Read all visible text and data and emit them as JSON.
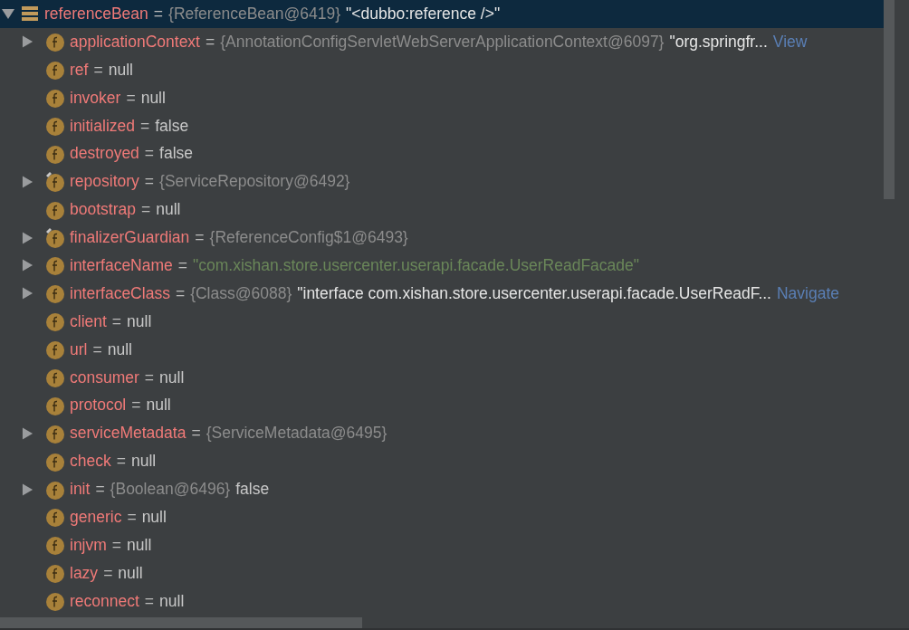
{
  "equals": "=",
  "root": {
    "name": "referenceBean",
    "expanded": true,
    "selected": true,
    "parts": [
      {
        "kind": "type",
        "text": "{ReferenceBean@6419}"
      },
      {
        "kind": "string",
        "text": "\"<dubbo:reference />\""
      }
    ]
  },
  "children": [
    {
      "name": "applicationContext",
      "expandable": true,
      "expanded": false,
      "pinned": false,
      "parts": [
        {
          "kind": "type",
          "text": "{AnnotationConfigServletWebServerApplicationContext@6097}"
        },
        {
          "kind": "string",
          "text": "\"org.springfr..."
        },
        {
          "kind": "link",
          "text": "View"
        }
      ]
    },
    {
      "name": "ref",
      "expandable": false,
      "pinned": false,
      "parts": [
        {
          "kind": "plain",
          "text": "null"
        }
      ]
    },
    {
      "name": "invoker",
      "expandable": false,
      "pinned": false,
      "parts": [
        {
          "kind": "plain",
          "text": "null"
        }
      ]
    },
    {
      "name": "initialized",
      "expandable": false,
      "pinned": false,
      "parts": [
        {
          "kind": "plain",
          "text": "false"
        }
      ]
    },
    {
      "name": "destroyed",
      "expandable": false,
      "pinned": false,
      "parts": [
        {
          "kind": "plain",
          "text": "false"
        }
      ]
    },
    {
      "name": "repository",
      "expandable": true,
      "expanded": false,
      "pinned": true,
      "parts": [
        {
          "kind": "type",
          "text": "{ServiceRepository@6492}"
        }
      ]
    },
    {
      "name": "bootstrap",
      "expandable": false,
      "pinned": false,
      "parts": [
        {
          "kind": "plain",
          "text": "null"
        }
      ]
    },
    {
      "name": "finalizerGuardian",
      "expandable": true,
      "expanded": false,
      "pinned": true,
      "parts": [
        {
          "kind": "type",
          "text": "{ReferenceConfig$1@6493}"
        }
      ]
    },
    {
      "name": "interfaceName",
      "expandable": true,
      "expanded": false,
      "pinned": false,
      "parts": [
        {
          "kind": "green",
          "text": "\"com.xishan.store.usercenter.userapi.facade.UserReadFacade\""
        }
      ]
    },
    {
      "name": "interfaceClass",
      "expandable": true,
      "expanded": false,
      "pinned": false,
      "parts": [
        {
          "kind": "type",
          "text": "{Class@6088}"
        },
        {
          "kind": "string",
          "text": "\"interface com.xishan.store.usercenter.userapi.facade.UserReadF..."
        },
        {
          "kind": "link",
          "text": "Navigate"
        }
      ]
    },
    {
      "name": "client",
      "expandable": false,
      "pinned": false,
      "parts": [
        {
          "kind": "plain",
          "text": "null"
        }
      ]
    },
    {
      "name": "url",
      "expandable": false,
      "pinned": false,
      "parts": [
        {
          "kind": "plain",
          "text": "null"
        }
      ]
    },
    {
      "name": "consumer",
      "expandable": false,
      "pinned": false,
      "parts": [
        {
          "kind": "plain",
          "text": "null"
        }
      ]
    },
    {
      "name": "protocol",
      "expandable": false,
      "pinned": false,
      "parts": [
        {
          "kind": "plain",
          "text": "null"
        }
      ]
    },
    {
      "name": "serviceMetadata",
      "expandable": true,
      "expanded": false,
      "pinned": false,
      "parts": [
        {
          "kind": "type",
          "text": "{ServiceMetadata@6495}"
        }
      ]
    },
    {
      "name": "check",
      "expandable": false,
      "pinned": false,
      "parts": [
        {
          "kind": "plain",
          "text": "null"
        }
      ]
    },
    {
      "name": "init",
      "expandable": true,
      "expanded": false,
      "pinned": false,
      "parts": [
        {
          "kind": "type",
          "text": "{Boolean@6496}"
        },
        {
          "kind": "plain",
          "text": "false"
        }
      ]
    },
    {
      "name": "generic",
      "expandable": false,
      "pinned": false,
      "parts": [
        {
          "kind": "plain",
          "text": "null"
        }
      ]
    },
    {
      "name": "injvm",
      "expandable": false,
      "pinned": false,
      "parts": [
        {
          "kind": "plain",
          "text": "null"
        }
      ]
    },
    {
      "name": "lazy",
      "expandable": false,
      "pinned": false,
      "parts": [
        {
          "kind": "plain",
          "text": "null"
        }
      ]
    },
    {
      "name": "reconnect",
      "expandable": false,
      "pinned": false,
      "parts": [
        {
          "kind": "plain",
          "text": "null"
        }
      ]
    }
  ]
}
